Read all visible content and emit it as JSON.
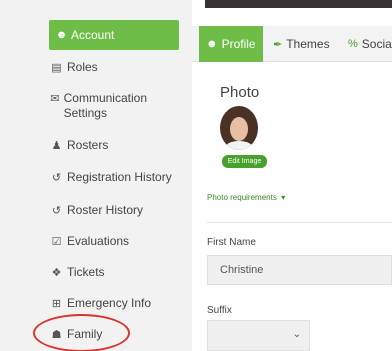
{
  "sidebar": {
    "active_label": "Account",
    "items": [
      {
        "label": "Roles",
        "icon": "id-card-icon"
      },
      {
        "label": "Communication Settings",
        "icon": "envelope-icon"
      },
      {
        "label": "Rosters",
        "icon": "users-icon"
      },
      {
        "label": "Registration History",
        "icon": "history-icon"
      },
      {
        "label": "Roster History",
        "icon": "history-icon"
      },
      {
        "label": "Evaluations",
        "icon": "calendar-check-icon"
      },
      {
        "label": "Tickets",
        "icon": "ticket-icon"
      },
      {
        "label": "Emergency Info",
        "icon": "plus-square-icon"
      },
      {
        "label": "Family",
        "icon": "sitemap-icon"
      }
    ]
  },
  "tabs": [
    {
      "label": "Profile",
      "icon": "user-circle-icon",
      "active": true
    },
    {
      "label": "Themes",
      "icon": "brush-icon",
      "active": false
    },
    {
      "label": "Social",
      "icon": "share-icon",
      "active": false
    }
  ],
  "profile": {
    "photo_heading": "Photo",
    "edit_image": "Edit Image",
    "photo_requirements": "Photo requirements",
    "first_name_label": "First Name",
    "first_name_value": "Christine",
    "suffix_label": "Suffix"
  },
  "colors": {
    "accent": "#6ebd48",
    "annotation": "#d9342b"
  }
}
